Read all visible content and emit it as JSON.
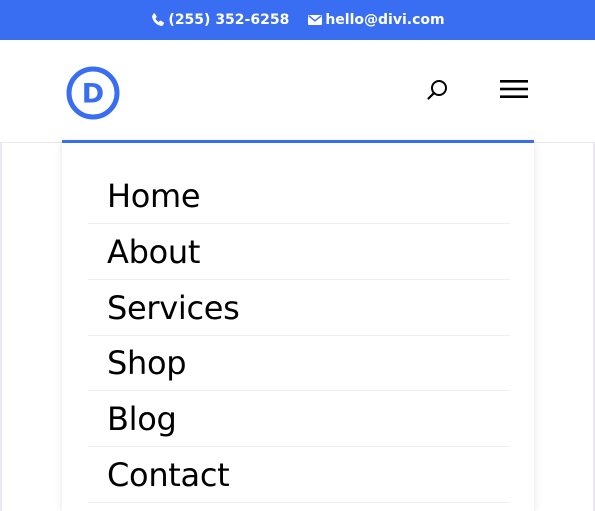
{
  "top_bar": {
    "phone": "(255) 352-6258",
    "email": "hello@divi.com",
    "phone_icon": "phone-icon",
    "email_icon": "envelope-icon"
  },
  "header": {
    "logo_letter": "D",
    "logo_icon": "divi-logo",
    "search_icon": "search-icon",
    "menu_icon": "hamburger-menu-icon"
  },
  "menu": {
    "items": [
      {
        "label": "Home"
      },
      {
        "label": "About"
      },
      {
        "label": "Services"
      },
      {
        "label": "Shop"
      },
      {
        "label": "Blog"
      },
      {
        "label": "Contact"
      }
    ]
  },
  "colors": {
    "accent": "#3a6ef2",
    "text": "#000000",
    "divider": "#eeeeee"
  }
}
